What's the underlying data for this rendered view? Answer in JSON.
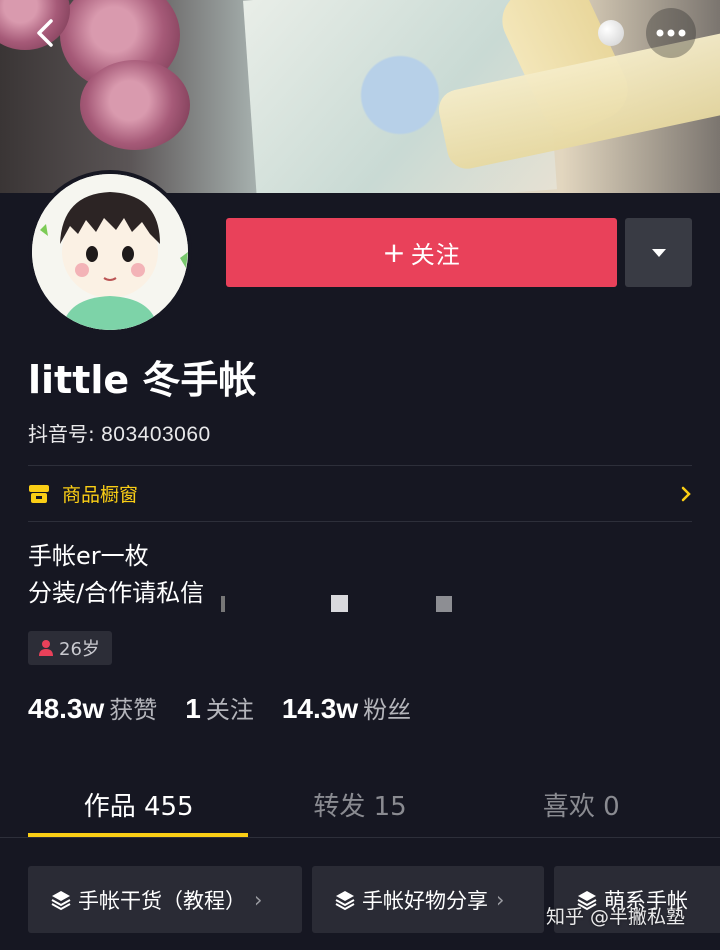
{
  "profile": {
    "nickname": "little 冬手帐",
    "douyin_id_label": "抖音号: ",
    "douyin_id": "803403060",
    "bio_line1": "手帐er一枚",
    "bio_line2": "分装/合作请私信",
    "age": "26岁"
  },
  "actions": {
    "follow_plus": "+",
    "follow_label": "关注"
  },
  "shop": {
    "label": "商品橱窗"
  },
  "stats": [
    {
      "value": "48.3w",
      "label": "获赞"
    },
    {
      "value": "1",
      "label": "关注"
    },
    {
      "value": "14.3w",
      "label": "粉丝"
    }
  ],
  "tabs": [
    {
      "label": "作品 455",
      "active": true
    },
    {
      "label": "转发 15",
      "active": false
    },
    {
      "label": "喜欢 0",
      "active": false
    }
  ],
  "collections": [
    {
      "label": "手帐干货（教程）"
    },
    {
      "label": "手帐好物分享"
    },
    {
      "label": "萌系手帐"
    }
  ],
  "watermark": "知乎 @半撇私塾",
  "colors": {
    "background": "#161722",
    "follow_button": "#e9415a",
    "accent_yellow": "#face15",
    "tab_indicator": "#face15"
  },
  "icons": {
    "back": "chevron-left-icon",
    "more": "more-dots-icon",
    "dropdown": "caret-down-icon",
    "shop": "shop-icon",
    "age": "person-icon",
    "collection": "layers-icon"
  }
}
